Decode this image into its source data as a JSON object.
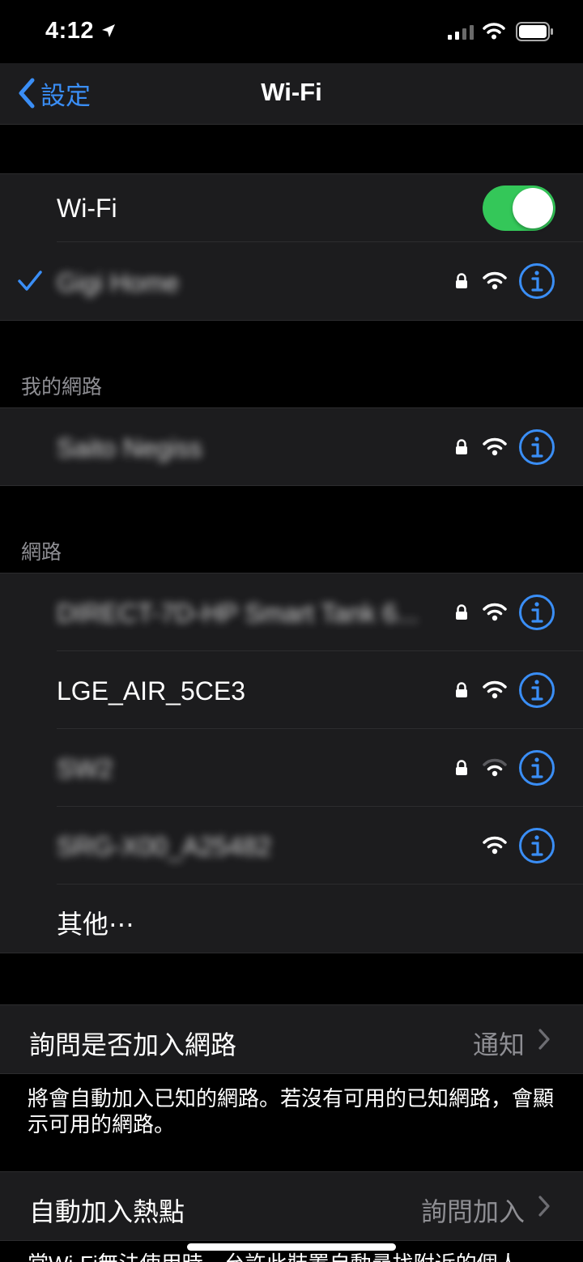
{
  "status_bar": {
    "time": "4:12"
  },
  "nav": {
    "back_label": "設定",
    "title": "Wi-Fi"
  },
  "wifi_toggle": {
    "label": "Wi-Fi",
    "on": true,
    "on_color": "#34c759"
  },
  "current_network": {
    "name": "Gigi Home",
    "secured": true
  },
  "my_networks": {
    "header": "我的網路",
    "items": [
      {
        "name": "Saito Negiss",
        "secured": true
      }
    ]
  },
  "networks": {
    "header": "網路",
    "items": [
      {
        "name": "DIRECT-7D-HP Smart Tank 6...",
        "secured": true,
        "blurred": true
      },
      {
        "name": "LGE_AIR_5CE3",
        "secured": true,
        "blurred": false
      },
      {
        "name": "SW2",
        "secured": true,
        "blurred": true
      },
      {
        "name": "SRG-X00_A25482",
        "secured": false,
        "blurred": true
      }
    ],
    "other_label": "其他⋯"
  },
  "ask_to_join": {
    "label": "詢問是否加入網路",
    "value": "通知",
    "footer": "將會自動加入已知的網路。若沒有可用的已知網路，會顯示可用的網路。"
  },
  "auto_join_hotspot": {
    "label": "自動加入熱點",
    "value": "詢問加入",
    "footer": "當Wi-Fi無法使用時，允許此裝置自動尋找附近的個人"
  },
  "colors": {
    "accent": "#3a8ef6",
    "toggle_on": "#34c759",
    "cell_bg": "#1c1c1e",
    "secondary_text": "#8e8e93"
  }
}
